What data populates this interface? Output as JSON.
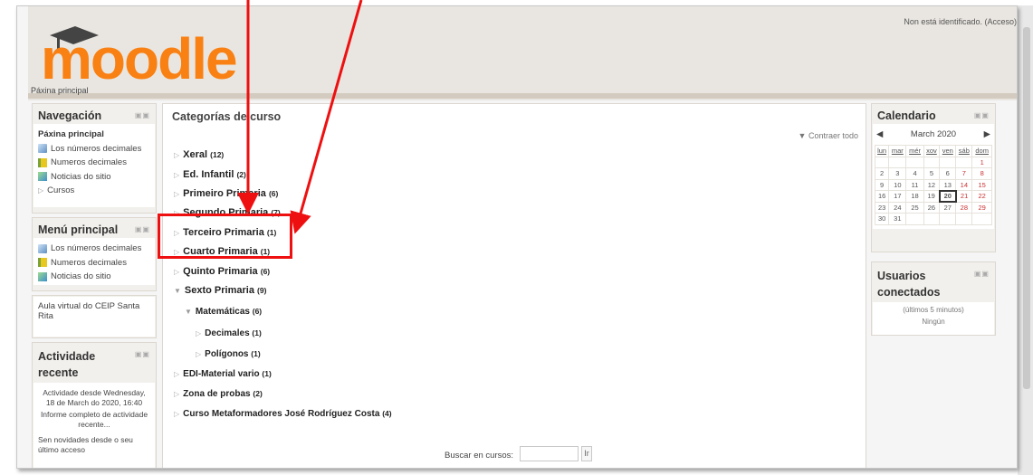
{
  "header": {
    "logo_text": "moodle",
    "login_info": "Non está identificado. (Acceso)",
    "breadcrumb": "Páxina principal"
  },
  "navigation": {
    "title": "Navegación",
    "home": "Páxina principal",
    "items": [
      {
        "label": "Los números decimales",
        "icon": "page-icon"
      },
      {
        "label": "Numeros decimales",
        "icon": "folder-icon"
      },
      {
        "label": "Noticias do sitio",
        "icon": "forum-icon"
      },
      {
        "label": "Cursos",
        "icon": "expand-triangle-icon"
      }
    ]
  },
  "main_menu": {
    "title": "Menú principal",
    "items": [
      {
        "label": "Los números decimales",
        "icon": "page-icon"
      },
      {
        "label": "Numeros decimales",
        "icon": "folder-icon"
      },
      {
        "label": "Noticias do sitio",
        "icon": "forum-icon"
      }
    ]
  },
  "site_text": "Aula virtual do CEIP Santa Rita",
  "recent_activity": {
    "title": "Actividade recente",
    "since": "Actividade desde Wednesday, 18 de March do 2020, 16:40",
    "full_report": "Informe completo de actividade recente...",
    "no_news": "Sen novidades desde o seu último acceso"
  },
  "categories": {
    "title": "Categorías de curso",
    "collapse_all": "Contraer todo",
    "items": [
      {
        "name": "Xeral",
        "count": "(12)",
        "state": "collapsed"
      },
      {
        "name": "Ed. Infantil",
        "count": "(2)",
        "state": "collapsed"
      },
      {
        "name": "Primeiro Primaria",
        "count": "(6)",
        "state": "collapsed"
      },
      {
        "name": "Segundo Primaria",
        "count": "(7)",
        "state": "collapsed"
      },
      {
        "name": "Terceiro Primaria",
        "count": "(1)",
        "state": "collapsed"
      },
      {
        "name": "Cuarto Primaria",
        "count": "(1)",
        "state": "collapsed"
      },
      {
        "name": "Quinto Primaria",
        "count": "(6)",
        "state": "collapsed"
      },
      {
        "name": "Sexto Primaria",
        "count": "(9)",
        "state": "expanded"
      },
      {
        "name": "Matemáticas",
        "count": "(6)",
        "state": "expanded"
      },
      {
        "name": "Decimales",
        "count": "(1)",
        "state": "collapsed"
      },
      {
        "name": "Polígonos",
        "count": "(1)",
        "state": "collapsed"
      },
      {
        "name": "EDI-Material vario",
        "count": "(1)",
        "state": "collapsed"
      },
      {
        "name": "Zona de probas",
        "count": "(2)",
        "state": "collapsed"
      },
      {
        "name": "Curso Metaformadores José Rodríguez Costa",
        "count": "(4)",
        "state": "collapsed"
      }
    ],
    "search_label": "Buscar en cursos:",
    "search_value": "",
    "search_button": "Ir"
  },
  "calendar": {
    "title": "Calendario",
    "month": "March 2020",
    "days": [
      "lun",
      "mar",
      "mér",
      "xov",
      "ven",
      "sáb",
      "dom"
    ],
    "weeks": [
      [
        "",
        "",
        "",
        "",
        "",
        "",
        "1"
      ],
      [
        "2",
        "3",
        "4",
        "5",
        "6",
        "7",
        "8"
      ],
      [
        "9",
        "10",
        "11",
        "12",
        "13",
        "14",
        "15"
      ],
      [
        "16",
        "17",
        "18",
        "19",
        "20",
        "21",
        "22"
      ],
      [
        "23",
        "24",
        "25",
        "26",
        "27",
        "28",
        "29"
      ],
      [
        "30",
        "31",
        "",
        "",
        "",
        "",
        ""
      ]
    ],
    "today": "20"
  },
  "online_users": {
    "title": "Usuarios conectados",
    "subtitle": "(últimos 5 minutos)",
    "none": "Ningún"
  },
  "colors": {
    "annotation_red": "#ee1010",
    "header_bg": "#e9e6e1",
    "logo_orange": "#f98012"
  }
}
